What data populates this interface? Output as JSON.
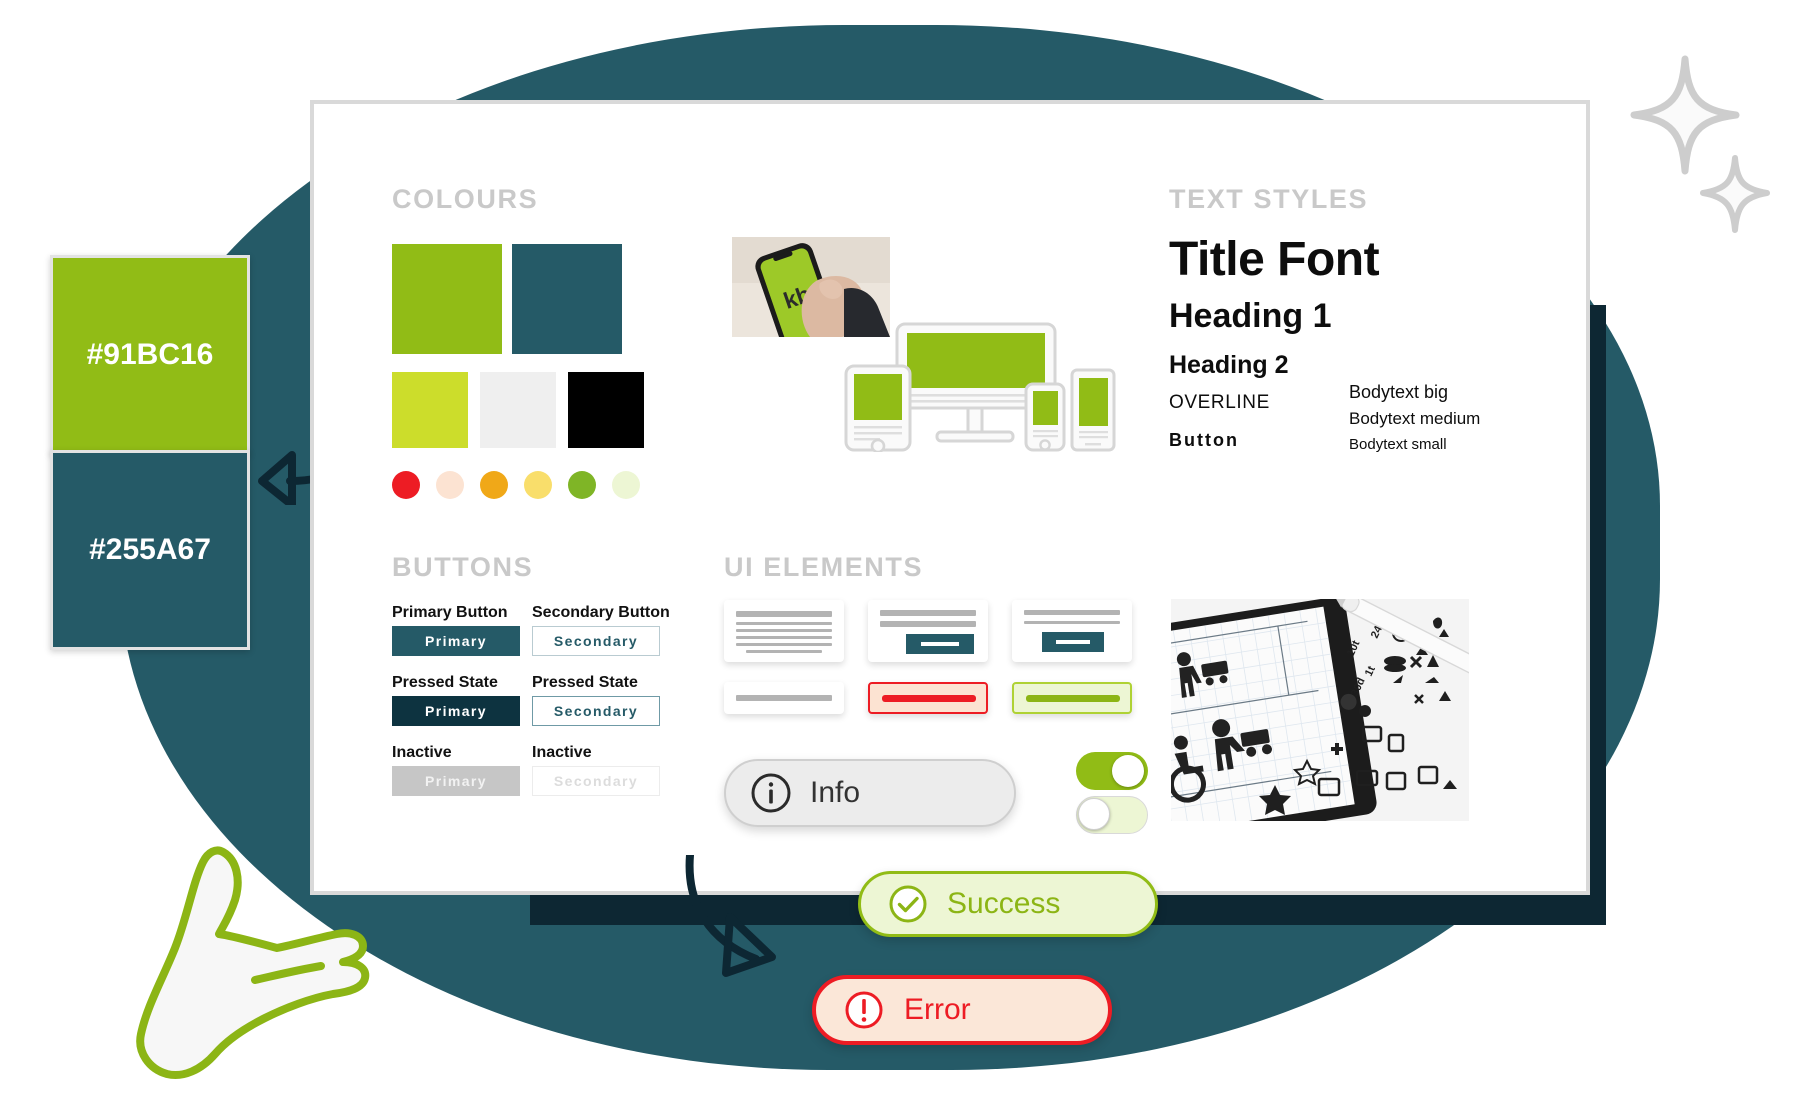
{
  "palette": {
    "green": "#91BC16",
    "teal": "#255A67",
    "dark_navy": "#0D2733",
    "lime": "#CCDD2B",
    "light_grey": "#EFEFEF",
    "black": "#000000",
    "red": "#ED1C24",
    "pale_peach": "#FCE3D2",
    "orange": "#F0A818",
    "yellow": "#F9DE6B",
    "pale_green": "#EDF6D4",
    "section_title_grey": "#C9C9C9"
  },
  "hex_swatches": [
    {
      "label": "#91BC16",
      "color": "#91BC16"
    },
    {
      "label": "#255A67",
      "color": "#255A67"
    }
  ],
  "sections": {
    "colours": "COLOURS",
    "text_styles": "TEXT STYLES",
    "buttons": "BUTTONS",
    "ui_elements": "UI ELEMENTS"
  },
  "colour_swatches": {
    "big": [
      {
        "name": "brand-green",
        "color": "#91BC16"
      },
      {
        "name": "brand-teal",
        "color": "#255A67"
      }
    ],
    "small": [
      {
        "name": "lime",
        "color": "#CCDD2B"
      },
      {
        "name": "light-grey",
        "color": "#EFEFEF"
      },
      {
        "name": "black",
        "color": "#000000"
      }
    ],
    "dots": [
      {
        "name": "red",
        "color": "#ED1C24"
      },
      {
        "name": "pale-peach",
        "color": "#FCE3D2"
      },
      {
        "name": "orange",
        "color": "#F0A818"
      },
      {
        "name": "yellow",
        "color": "#F9DE6B"
      },
      {
        "name": "green",
        "color": "#7FB526"
      },
      {
        "name": "pale-green",
        "color": "#EDF6D4"
      }
    ]
  },
  "text_styles": {
    "title": "Title Font",
    "heading1": "Heading 1",
    "heading2": "Heading 2",
    "overline": "OVERLINE",
    "button": "Button",
    "body_big": "Bodytext big",
    "body_medium": "Bodytext medium",
    "body_small": "Bodytext small"
  },
  "buttons": {
    "groups": [
      {
        "label": "Primary Button",
        "text": "Primary",
        "state": "default"
      },
      {
        "label": "Secondary Button",
        "text": "Secondary",
        "state": "default"
      },
      {
        "label": "Pressed State",
        "text": "Primary",
        "state": "pressed"
      },
      {
        "label": "Pressed State",
        "text": "Secondary",
        "state": "pressed"
      },
      {
        "label": "Inactive",
        "text": "Primary",
        "state": "inactive"
      },
      {
        "label": "Inactive",
        "text": "Secondary",
        "state": "inactive"
      }
    ]
  },
  "pills": {
    "info": {
      "label": "Info",
      "icon": "info-circle-icon"
    },
    "success": {
      "label": "Success",
      "icon": "check-circle-icon"
    },
    "error": {
      "label": "Error",
      "icon": "alert-circle-icon"
    }
  },
  "toggles": [
    {
      "name": "toggle-on",
      "state": "on",
      "track": "#91BC16"
    },
    {
      "name": "toggle-off",
      "state": "off",
      "track": "#EDF6D4"
    }
  ],
  "images": {
    "phone_in_hand": {
      "alt": "hand-holding-phone",
      "logo": "kb"
    },
    "responsive_devices": {
      "alt": "responsive-device-mockups"
    },
    "tablet_icons": {
      "alt": "tablet-with-pictogram-icons-and-pencil"
    }
  },
  "decorations": {
    "sparkles": 2,
    "arrows": 2,
    "hand": "open-hand-illustration"
  }
}
